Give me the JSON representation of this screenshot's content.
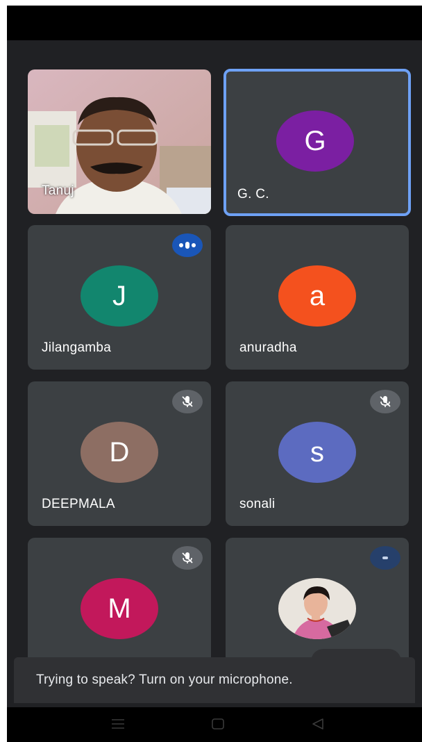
{
  "participants": [
    {
      "name": "Tanuj",
      "type": "video"
    },
    {
      "name": "G. C.",
      "initial": "G",
      "color": "#7b1fa2",
      "active": true
    },
    {
      "name": "Jilangamba",
      "initial": "J",
      "color": "#12866e",
      "badge": "speaking-indicator-icon"
    },
    {
      "name": "anuradha",
      "initial": "a",
      "color": "#f4511e"
    },
    {
      "name": "DEEPMALA",
      "initial": "D",
      "color": "#8d6e63",
      "badge": "mic-off-icon"
    },
    {
      "name": "sonali",
      "initial": "s",
      "color": "#5c6bc0",
      "badge": "mic-off-icon"
    },
    {
      "name": "",
      "initial": "M",
      "color": "#c2185b",
      "badge": "mic-off-icon"
    },
    {
      "name": "",
      "type": "photo",
      "badge": "speaking-indicator-icon"
    }
  ],
  "toast": {
    "message": "Trying to speak? Turn on your microphone."
  },
  "navbar": {
    "icons": [
      "menu-icon",
      "home-icon",
      "back-icon"
    ]
  }
}
